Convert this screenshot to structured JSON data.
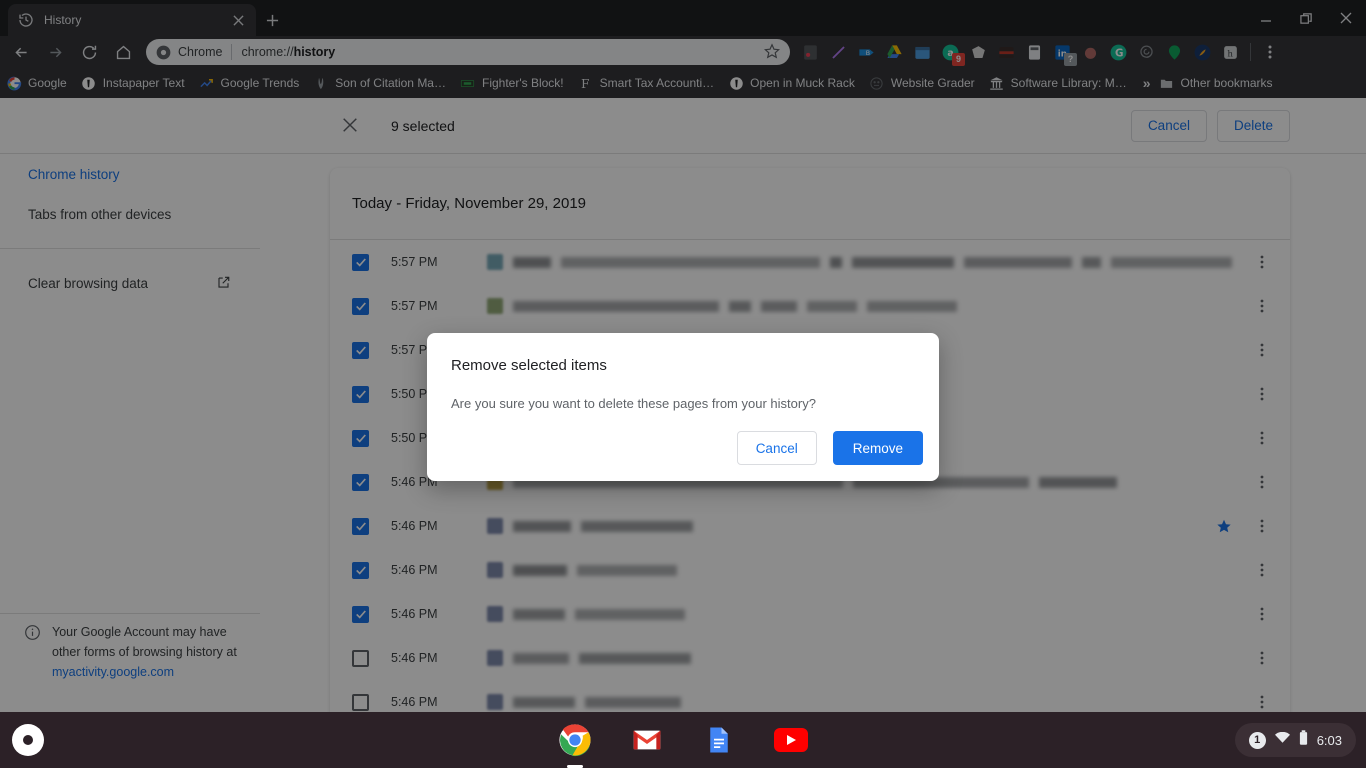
{
  "window": {
    "tab": {
      "title": "History",
      "favicon": "history-icon"
    },
    "controls": {
      "minimize": "minimize-icon",
      "restore": "restore-icon",
      "close": "close-icon"
    },
    "new_tab_label": "+"
  },
  "toolbar": {
    "back": "back-arrow-icon",
    "forward": "forward-arrow-icon",
    "reload": "reload-icon",
    "home": "home-icon",
    "omnibox": {
      "chip_label": "Chrome",
      "url_prefix": "chrome://",
      "url_bold": "history",
      "star": "star-outline-icon"
    },
    "extensions": [
      {
        "name": "pocket-icon",
        "color": "#ef4056",
        "badge": ""
      },
      {
        "name": "highlighter-icon",
        "color": "#b47cf5",
        "badge": ""
      },
      {
        "name": "bitly-icon",
        "color": "#1e90e0",
        "badge": ""
      },
      {
        "name": "google-drive-icon",
        "color": "#ffc107",
        "badge": ""
      },
      {
        "name": "calendar-icon",
        "color": "#4d9de0",
        "badge": ""
      },
      {
        "name": "grammarly-icon",
        "color": "#15c39a",
        "badge": "9"
      },
      {
        "name": "evernote-icon",
        "color": "#d8d8d8",
        "badge": ""
      },
      {
        "name": "hamburger-app-icon",
        "color": "#c0392b",
        "badge": ""
      },
      {
        "name": "calculator-icon",
        "color": "#e8eaed",
        "badge": ""
      },
      {
        "name": "linkedin-icon",
        "color": "#0a66c2",
        "badge": "?"
      },
      {
        "name": "apple-icon",
        "color": "#b26a67",
        "badge": ""
      },
      {
        "name": "grammarly-g-icon",
        "color": "#15c39a",
        "badge": ""
      },
      {
        "name": "mention-icon",
        "color": "#8a8f94",
        "badge": ""
      },
      {
        "name": "location-pin-icon",
        "color": "#11a75c",
        "badge": ""
      },
      {
        "name": "semrush-icon",
        "color": "#1b3a6b",
        "badge": ""
      },
      {
        "name": "hootsuite-icon",
        "color": "#cfd3d6",
        "badge": ""
      }
    ],
    "menu": "kebab-menu-icon"
  },
  "bookmarks": {
    "items": [
      {
        "label": "Google",
        "icon": "google-icon",
        "color": "#4285f4"
      },
      {
        "label": "Instapaper Text",
        "icon": "instapaper-icon",
        "color": "#ffffff"
      },
      {
        "label": "Google Trends",
        "icon": "trends-icon",
        "color": "#4285f4"
      },
      {
        "label": "Son of Citation Ma…",
        "icon": "citation-icon",
        "color": "#9aa0a6"
      },
      {
        "label": "Fighter's Block!",
        "icon": "fighters-block-icon",
        "color": "#34a853"
      },
      {
        "label": "Smart Tax Accounti…",
        "icon": "smart-tax-icon",
        "color": "#e8eaed"
      },
      {
        "label": "Open in Muck Rack",
        "icon": "muckrack-icon",
        "color": "#ffffff"
      },
      {
        "label": "Website Grader",
        "icon": "website-grader-icon",
        "color": "#5f6368"
      },
      {
        "label": "Software Library: M…",
        "icon": "archive-icon",
        "color": "#e8eaed"
      }
    ],
    "overflow": "»",
    "other_bookmarks": {
      "label": "Other bookmarks",
      "icon": "folder-icon"
    }
  },
  "page": {
    "header": {
      "close_icon": "close-selection-icon",
      "selected_count": "9 selected",
      "cancel_label": "Cancel",
      "delete_label": "Delete"
    },
    "sidebar": {
      "items": [
        {
          "label": "Chrome history",
          "active": true
        },
        {
          "label": "Tabs from other devices",
          "active": false
        }
      ],
      "clear_browsing_data": {
        "label": "Clear browsing data",
        "icon": "open-external-icon"
      },
      "note": {
        "icon": "info-icon",
        "text_before": "Your Google Account may have other forms of browsing history at ",
        "link": "myactivity.google.com"
      }
    },
    "history": {
      "date_header": "Today - Friday, November 29, 2019",
      "rows": [
        {
          "time": "5:57 PM",
          "checked": true,
          "starred": false,
          "favicon": "#4a8ba0",
          "redactions": [
            44,
            300,
            14,
            118,
            126,
            22,
            140
          ]
        },
        {
          "time": "5:57 PM",
          "checked": true,
          "starred": false,
          "favicon": "#6e8b4a",
          "redactions": [
            206,
            22,
            36,
            50,
            90
          ]
        },
        {
          "time": "5:57 PM",
          "checked": true,
          "starred": false,
          "favicon": "#9aa0a6",
          "redactions": [
            150,
            60,
            120
          ]
        },
        {
          "time": "5:50 PM",
          "checked": true,
          "starred": false,
          "favicon": "#9aa0a6",
          "redactions": [
            180,
            40,
            90
          ]
        },
        {
          "time": "5:50 PM",
          "checked": true,
          "starred": false,
          "favicon": "#9aa0a6",
          "redactions": [
            160,
            70,
            110
          ]
        },
        {
          "time": "5:46 PM",
          "checked": true,
          "starred": false,
          "favicon": "#a8860b",
          "redactions": [
            330,
            176,
            78
          ]
        },
        {
          "time": "5:46 PM",
          "checked": true,
          "starred": true,
          "favicon": "#53638f",
          "redactions": [
            58,
            112
          ]
        },
        {
          "time": "5:46 PM",
          "checked": true,
          "starred": false,
          "favicon": "#53638f",
          "redactions": [
            54,
            100
          ]
        },
        {
          "time": "5:46 PM",
          "checked": true,
          "starred": false,
          "favicon": "#53638f",
          "redactions": [
            52,
            110
          ]
        },
        {
          "time": "5:46 PM",
          "checked": false,
          "starred": false,
          "favicon": "#53638f",
          "redactions": [
            56,
            112
          ]
        },
        {
          "time": "5:46 PM",
          "checked": false,
          "starred": false,
          "favicon": "#53638f",
          "redactions": [
            62,
            96
          ]
        }
      ],
      "row_menu_icon": "kebab-menu-icon",
      "starred_icon": "star-filled-icon"
    }
  },
  "dialog": {
    "title": "Remove selected items",
    "body": "Are you sure you want to delete these pages from your history?",
    "cancel_label": "Cancel",
    "confirm_label": "Remove"
  },
  "shelf": {
    "launcher": "launcher-icon",
    "apps": [
      {
        "name": "chrome-app-icon",
        "active": true
      },
      {
        "name": "gmail-app-icon",
        "active": false
      },
      {
        "name": "google-docs-app-icon",
        "active": false
      },
      {
        "name": "youtube-app-icon",
        "active": false
      }
    ],
    "tray": {
      "notification_count": "1",
      "wifi_icon": "wifi-icon",
      "battery_icon": "battery-icon",
      "time": "6:03"
    }
  },
  "colors": {
    "accent": "#1a73e8",
    "scrim": "rgba(0,0,0,0.45)",
    "shelf_bg": "#2c2127",
    "chrome_dark": "#35363a"
  }
}
